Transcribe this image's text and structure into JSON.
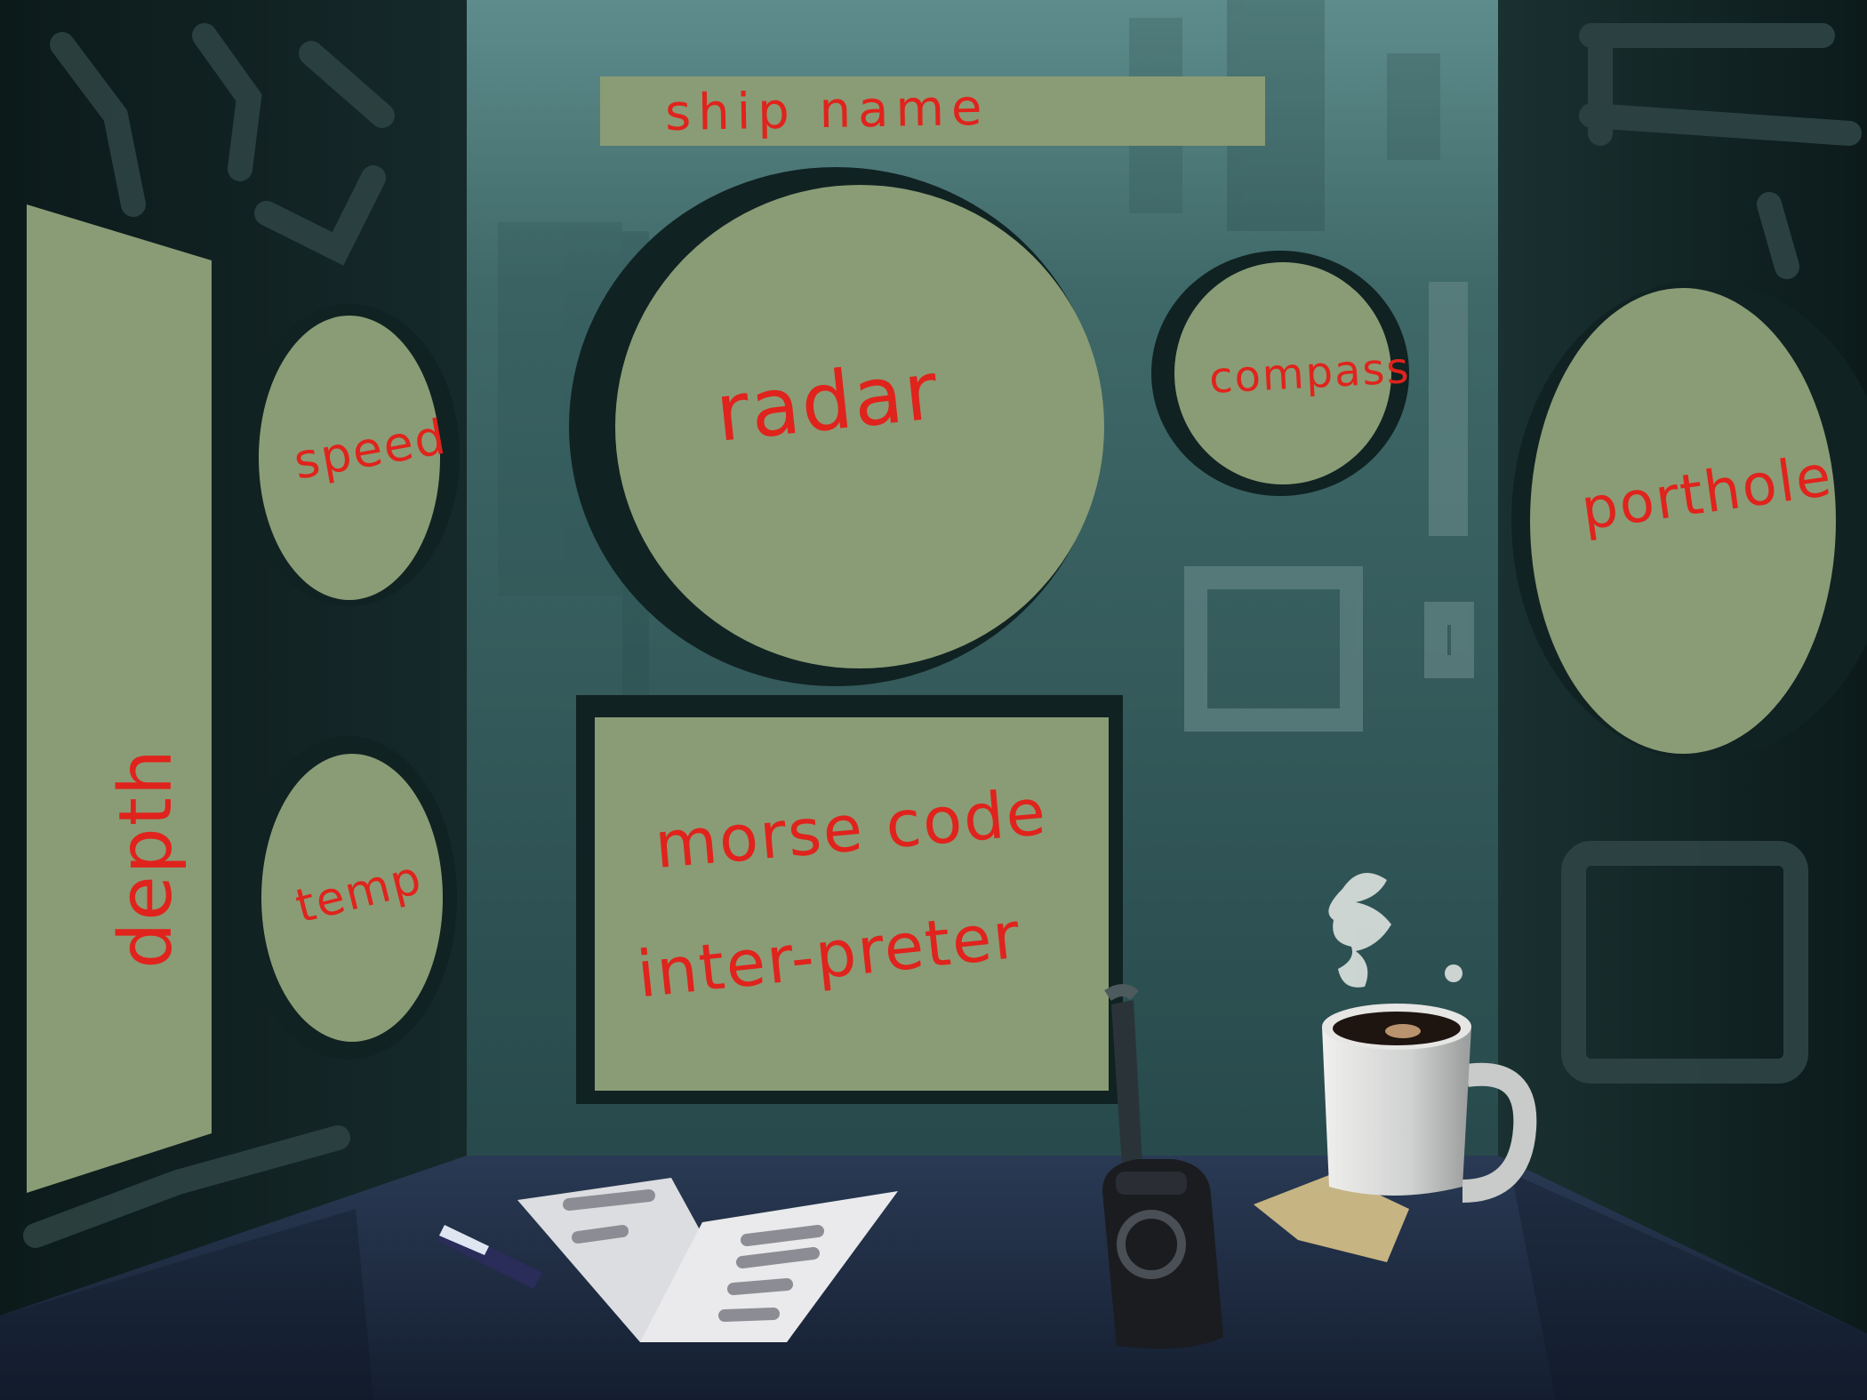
{
  "panels": {
    "ship_name": {
      "label": "ship name"
    },
    "radar": {
      "label": "radar"
    },
    "compass": {
      "label": "compass"
    },
    "porthole": {
      "label": "porthole"
    },
    "speed": {
      "label": "speed"
    },
    "temp": {
      "label": "temp"
    },
    "depth": {
      "label": "depth"
    },
    "morse": {
      "line1": "morse code",
      "line2": "inter-preter"
    }
  },
  "colors": {
    "panel_fill": "#8a9c75",
    "label_red": "#e0231c",
    "wall_teal": "#3d6565",
    "wall_dark": "#0f1e1e",
    "desk_blue": "#1f2d44"
  },
  "desk_items": [
    "paper-sheets",
    "pen",
    "coffee-mug",
    "coaster",
    "rotary-phone"
  ]
}
